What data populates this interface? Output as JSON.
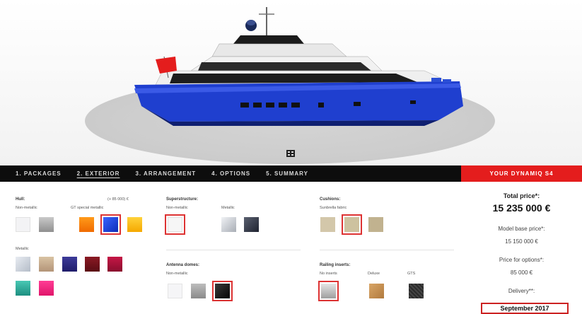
{
  "nav": {
    "tabs": [
      "1. PACKAGES",
      "2. EXTERIOR",
      "3. ARRANGEMENT",
      "4. OPTIONS",
      "5. SUMMARY"
    ],
    "active_index": 1,
    "model_label": "YOUR DYNAMIQ S4"
  },
  "colors": {
    "accent": "#e41d1d",
    "nav_bg": "#0d0d0d",
    "hull_blue": "#1f3fcf"
  },
  "hull": {
    "title": "Hull:",
    "price": "(+ 85 000) €",
    "non_metallic_label": "Non-metallic",
    "special_label": "GT special metallic",
    "metallic_label": "Metallic"
  },
  "superstructure": {
    "title": "Superstructure:",
    "non_metallic_label": "Non-metallic",
    "metallic_label": "Metallic"
  },
  "antenna": {
    "title": "Antenna domes:",
    "non_metallic_label": "Non-metallic"
  },
  "cushions": {
    "title": "Cushions:",
    "fabric_label": "Sunbrella fabric"
  },
  "railing": {
    "title": "Railing inserts:",
    "no_inserts_label": "No inserts",
    "deluxe_label": "Deluxe",
    "gts_label": "GTS"
  },
  "summary": {
    "total_label": "Total price*:",
    "total_value": "15 235 000 €",
    "base_label": "Model base price*:",
    "base_value": "15 150 000 €",
    "options_label": "Price for options*:",
    "options_value": "85 000 €",
    "delivery_label": "Delivery**:",
    "delivery_value": "September 2017"
  }
}
